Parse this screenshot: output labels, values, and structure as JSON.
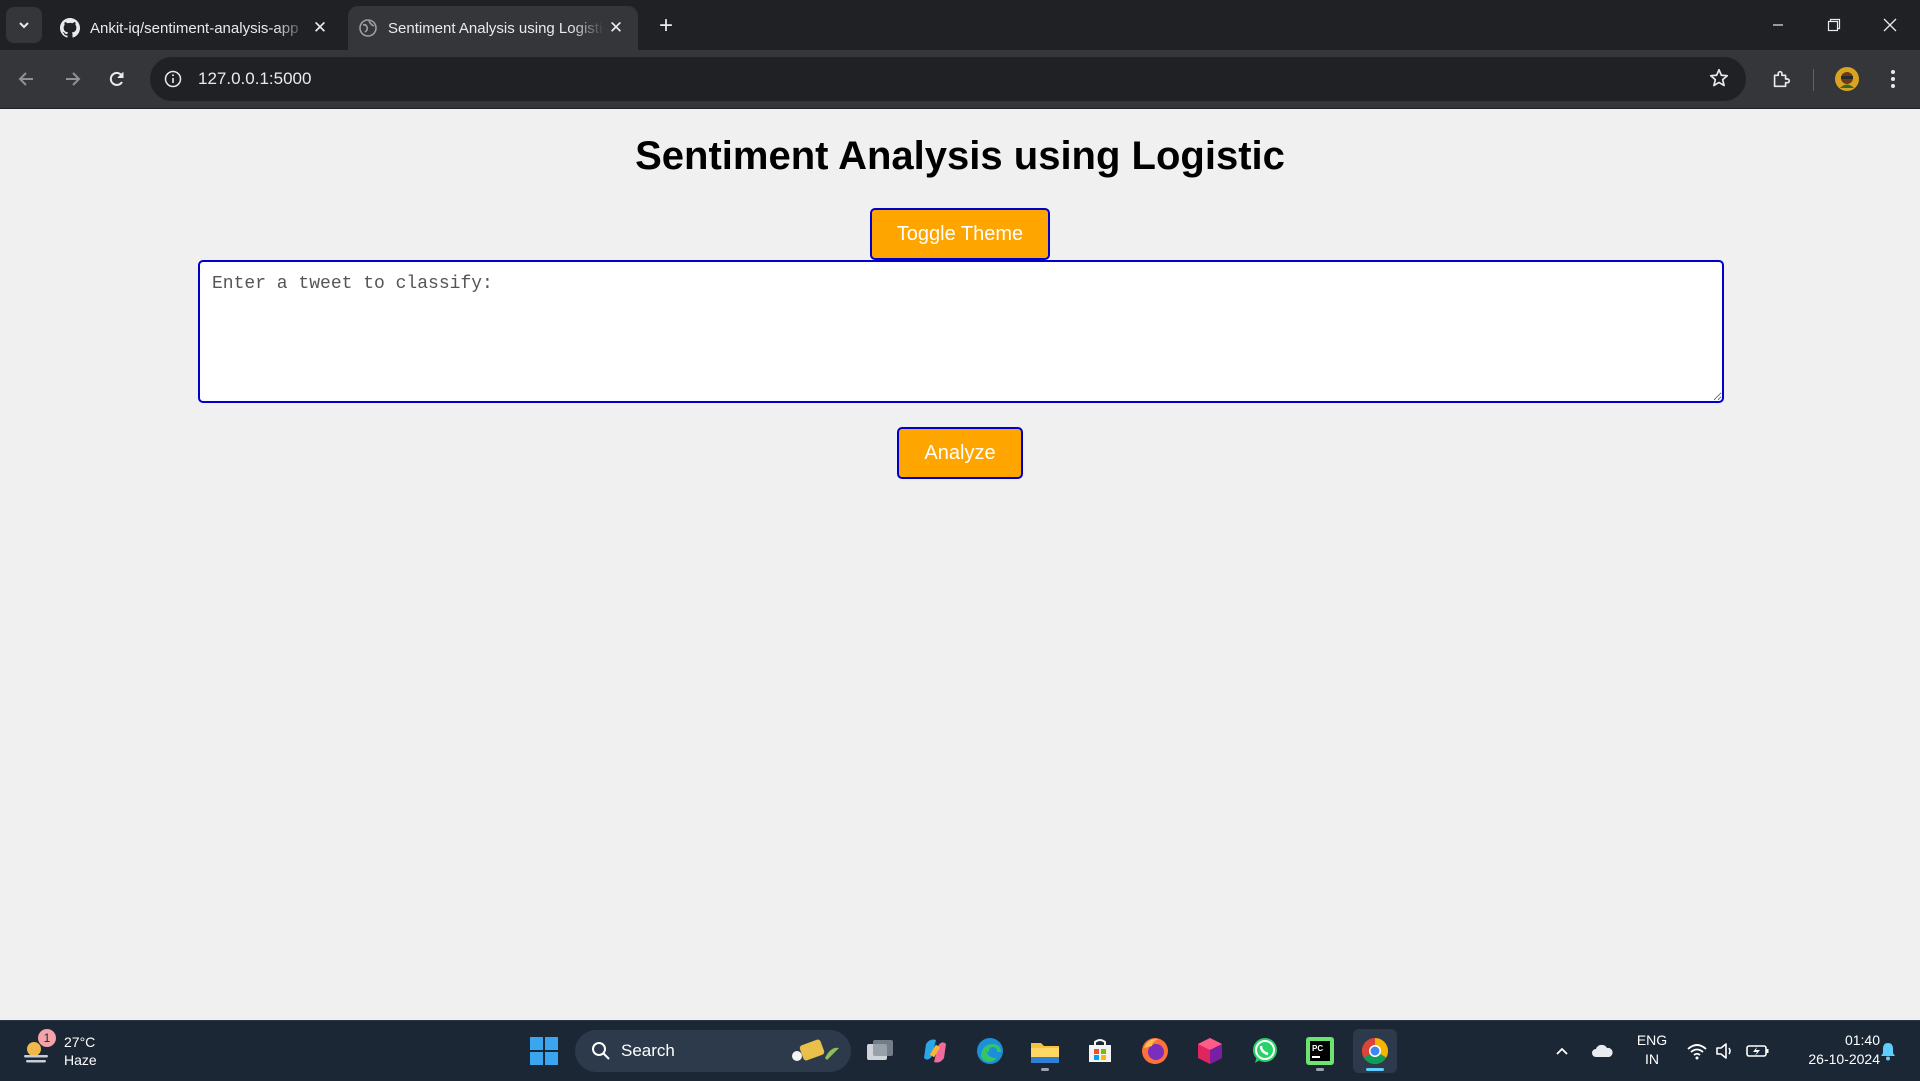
{
  "browser": {
    "tabs": [
      {
        "title": "Ankit-iq/sentiment-analysis-app",
        "active": false,
        "favicon": "github-icon"
      },
      {
        "title": "Sentiment Analysis using Logistic",
        "active": true,
        "favicon": "globe-icon"
      }
    ],
    "address": "127.0.0.1:5000"
  },
  "page": {
    "title": "Sentiment Analysis using Logistic",
    "toggle_theme_label": "Toggle Theme",
    "tweet_placeholder": "Enter a tweet to classify:",
    "analyze_label": "Analyze",
    "colors": {
      "button_bg": "#ffa500",
      "button_border": "#0000cc",
      "background": "#f0f0f0"
    }
  },
  "taskbar": {
    "weather": {
      "temp": "27°C",
      "condition": "Haze",
      "badge": "1"
    },
    "search_placeholder": "Search",
    "apps": [
      "task-view-icon",
      "copilot-icon",
      "edge-icon",
      "file-explorer-icon",
      "store-icon",
      "firefox-icon",
      "box-app-icon",
      "whatsapp-icon",
      "pycharm-icon",
      "chrome-icon"
    ],
    "lang": {
      "line1": "ENG",
      "line2": "IN"
    },
    "clock": {
      "time": "01:40",
      "date": "26-10-2024"
    }
  }
}
